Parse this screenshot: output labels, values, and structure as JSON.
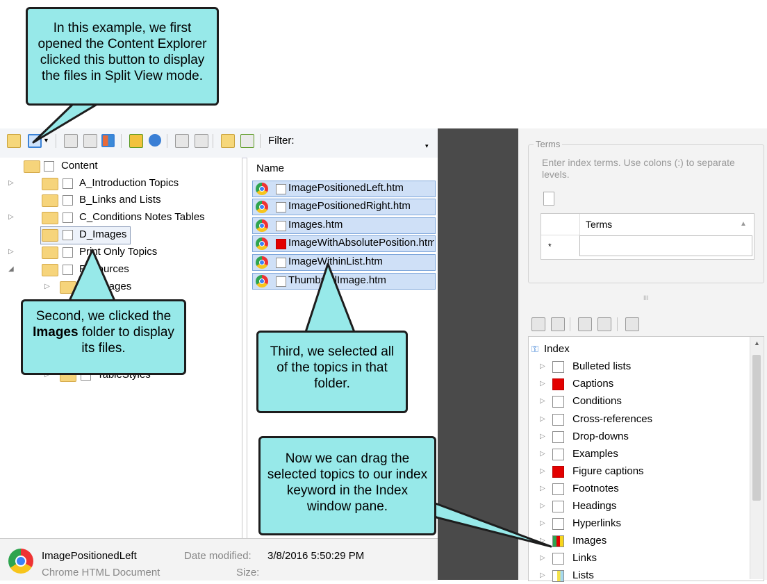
{
  "toolbar": {
    "filter_label": "Filter:"
  },
  "tree": {
    "items": [
      {
        "label": "Content"
      },
      {
        "label": "A_Introduction Topics"
      },
      {
        "label": "B_Links and Lists"
      },
      {
        "label": "C_Conditions Notes Tables"
      },
      {
        "label": "D_Images"
      },
      {
        "label": "Print Only Topics"
      },
      {
        "label": "Resources"
      },
      {
        "label": "Images"
      },
      {
        "label": "TableStyles"
      }
    ]
  },
  "file_list": {
    "header": "Name",
    "files": [
      {
        "name": "ImagePositionedLeft.htm"
      },
      {
        "name": "ImagePositionedRight.htm"
      },
      {
        "name": "Images.htm"
      },
      {
        "name": "ImageWithAbsolutePosition.htm"
      },
      {
        "name": "ImageWithinList.htm"
      },
      {
        "name": "ThumbnailImage.htm"
      }
    ]
  },
  "status": {
    "file_name": "ImagePositionedLeft",
    "file_type": "Chrome HTML Document",
    "date_label": "Date modified:",
    "date_value": "3/8/2016 5:50:29 PM",
    "size_label": "Size:"
  },
  "terms": {
    "legend": "Terms",
    "hint": "Enter index terms. Use colons (:) to separate levels.",
    "column": "Terms",
    "row_marker": "*"
  },
  "index": {
    "root": "Index",
    "entries": [
      {
        "label": "Bulleted lists"
      },
      {
        "label": "Captions"
      },
      {
        "label": "Conditions"
      },
      {
        "label": "Cross-references"
      },
      {
        "label": "Drop-downs"
      },
      {
        "label": "Examples"
      },
      {
        "label": "Figure captions"
      },
      {
        "label": "Footnotes"
      },
      {
        "label": "Headings"
      },
      {
        "label": "Hyperlinks"
      },
      {
        "label": "Images"
      },
      {
        "label": "Links"
      },
      {
        "label": "Lists"
      }
    ]
  },
  "callouts": {
    "c1": "In this example, we first opened the Content Explorer clicked this button to display the files in Split View mode.",
    "c2_pre": "Second, we clicked the ",
    "c2_bold": "Images",
    "c2_post": " folder to display its files.",
    "c3": "Third, we selected all of the topics in that folder.",
    "c4": "Now we can drag the selected topics to our index keyword in the Index window pane."
  },
  "colors": {
    "callout_fill": "#97e9e9",
    "selection": "#cfe0f7",
    "dark_panel": "#4a4a4a"
  }
}
